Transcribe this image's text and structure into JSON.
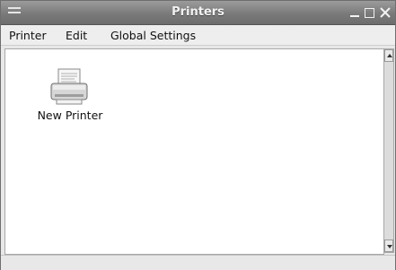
{
  "window": {
    "title": "Printers",
    "controls": {
      "minimize_icon": "minimize-icon",
      "maximize_icon": "maximize-icon",
      "close_icon": "close-icon"
    }
  },
  "menubar": {
    "items": [
      {
        "label": "Printer",
        "mnemonic": "P"
      },
      {
        "label": "Edit",
        "mnemonic": "E"
      },
      {
        "label": "Global Settings",
        "mnemonic": "G"
      }
    ]
  },
  "content": {
    "items": [
      {
        "label": "New Printer",
        "icon": "printer-icon"
      }
    ]
  },
  "colors": {
    "titlebar": "#7a7a7a",
    "title_text": "#f2f2f2",
    "menubar_bg": "#eeeeee",
    "content_bg": "#ffffff"
  }
}
